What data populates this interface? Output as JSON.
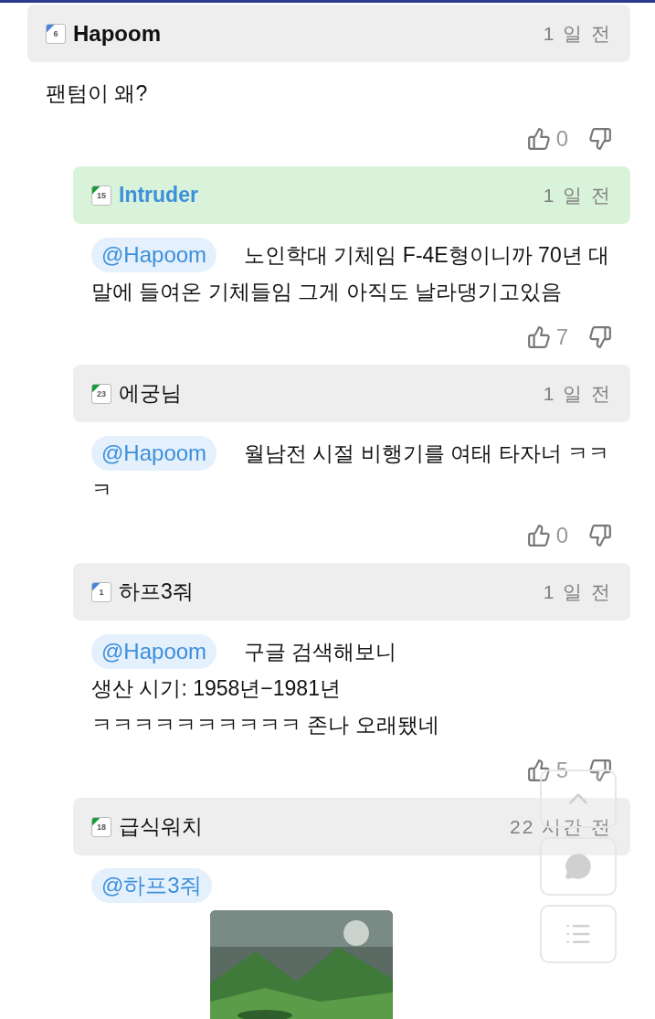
{
  "comments": [
    {
      "badge": "6",
      "color": "#4a86d8",
      "name": "Hapoom",
      "highlighted": false,
      "time": "1 일 전",
      "text": "팬텀이 왜?",
      "votes": "0",
      "children": [
        {
          "badge": "15",
          "color": "#1a9a3a",
          "name": "Intruder",
          "highlighted": true,
          "time": "1 일 전",
          "mention": "@Hapoom",
          "text": "노인학대 기체임 F-4E형이니까 70년 대말에 들여온 기체들임 그게 아직도 날라댕기고있음",
          "votes": "7"
        },
        {
          "badge": "23",
          "color": "#1a9a3a",
          "name": "에궁님",
          "highlighted": false,
          "time": "1 일 전",
          "mention": "@Hapoom",
          "text": "월남전 시절 비행기를 여태 타자너 ㅋㅋㅋ",
          "votes": "0"
        },
        {
          "badge": "1",
          "color": "#4a86d8",
          "name": "하프3줘",
          "highlighted": false,
          "time": "1 일 전",
          "mention": "@Hapoom",
          "text": "구글 검색해보니\n생산 시기: 1958년−1981년\nㅋㅋㅋㅋㅋㅋㅋㅋㅋㅋ 존나 오래됐네",
          "votes": "5"
        },
        {
          "badge": "18",
          "color": "#1a9a3a",
          "name": "급식워치",
          "highlighted": false,
          "time": "22 시간 전",
          "mention": "@하프3줘"
        }
      ]
    }
  ]
}
